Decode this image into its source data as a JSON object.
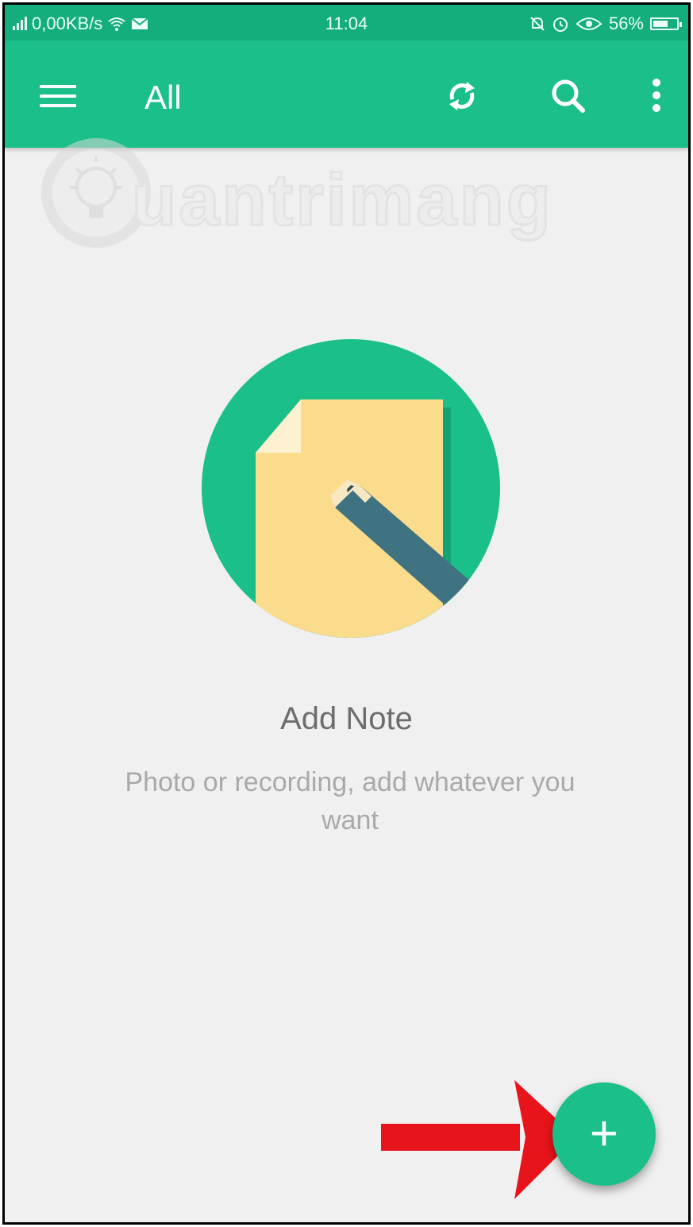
{
  "status_bar": {
    "network_speed": "0,00KB/s",
    "time": "11:04",
    "battery_level": "56%"
  },
  "app_bar": {
    "title": "All",
    "icons": [
      "menu-icon",
      "sync-icon",
      "search-icon",
      "more-vert-icon"
    ]
  },
  "watermark": {
    "text": "uantrimang"
  },
  "empty_state": {
    "title": "Add Note",
    "subtitle": "Photo or recording, add whatever you want",
    "illustration": "note-pencil-illustration"
  },
  "fab": {
    "label": "+",
    "icon": "add-icon"
  },
  "annotation": {
    "icon": "red-arrow-icon",
    "color": "#e8141b"
  },
  "colors": {
    "primary": "#1bbf8a",
    "status_bar": "#14ad7e",
    "background": "#f0f0f0",
    "paper": "#fbdb8c",
    "pencil": "#3f7382"
  }
}
